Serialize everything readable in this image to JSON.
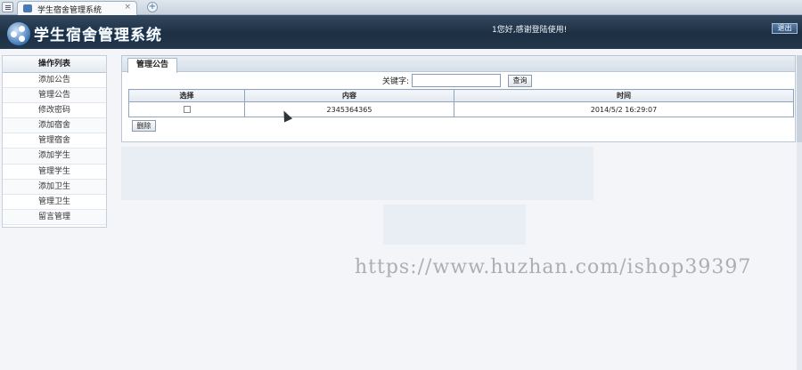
{
  "browser": {
    "tab_title": "学生宿舍管理系统",
    "tab_close": "×",
    "new_tab": "+"
  },
  "header": {
    "logo_text": "学生宿舍管理系统",
    "welcome": "1您好,感谢登陆使用!",
    "logout_label": "退出"
  },
  "sidebar": {
    "title": "操作列表",
    "items": [
      {
        "label": "添加公告"
      },
      {
        "label": "管理公告"
      },
      {
        "label": "修改密码"
      },
      {
        "label": "添加宿舍"
      },
      {
        "label": "管理宿舍"
      },
      {
        "label": "添加学生"
      },
      {
        "label": "管理学生"
      },
      {
        "label": "添加卫生"
      },
      {
        "label": "管理卫生"
      },
      {
        "label": "留言管理"
      }
    ]
  },
  "main": {
    "tab_label": "管理公告",
    "keyword_label": "关键字:",
    "keyword_value": "",
    "query_label": "查询",
    "table": {
      "headers": [
        "选择",
        "内容",
        "时间"
      ],
      "rows": [
        {
          "content": "2345364365",
          "time": "2014/5/2 16:29:07"
        }
      ]
    },
    "delete_label": "删除"
  },
  "watermark": "https://www.huzhan.com/ishop39397"
}
